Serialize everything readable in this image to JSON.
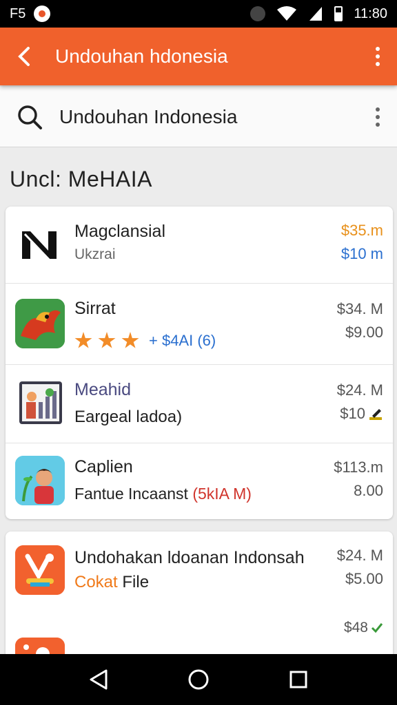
{
  "status_bar": {
    "left_text": "F5",
    "time": "11:80"
  },
  "app_bar": {
    "title": "Undouhan  hdonesia"
  },
  "search": {
    "query": "Undouhan Indonesia"
  },
  "section": {
    "title": "Uncl: MeHAIA"
  },
  "apps": [
    {
      "name": "Magclansial",
      "sub": "Ukzrai",
      "price1": "$35.m",
      "price2": "$10 m",
      "price1_color": "#e8901a",
      "price2_color": "#2a6fcf",
      "icon": "nd-logo-icon"
    },
    {
      "name": "Sirrat",
      "rating_text": "+ $4AI (6)",
      "rating": 3,
      "price1": "$34. M",
      "price2": "$9.00",
      "icon": "bird-icon"
    },
    {
      "name": "Meahid",
      "sub": "Eargeal ladoa)",
      "price1": "$24. M",
      "price2": "$10",
      "icon": "chart-icon"
    },
    {
      "name": "Caplien",
      "sub": "Fantue Incaanst",
      "sub_extra": "(5kIA M)",
      "price1": "$113.m",
      "price2": "8.00",
      "icon": "kid-icon"
    }
  ],
  "apps2": [
    {
      "name": "Undohakan ldoanan Indonsah",
      "sub_orange": "Cokat",
      "sub_rest": " File",
      "price1": "$24. M",
      "price2": "$5.00",
      "icon": "tool-icon"
    },
    {
      "name": "",
      "price1": "$48",
      "icon": "orange-app-icon"
    }
  ],
  "colors": {
    "accent": "#f0612c",
    "star": "#f28c28",
    "rating_text": "#2a6fcf",
    "sub_red": "#d0342c"
  }
}
